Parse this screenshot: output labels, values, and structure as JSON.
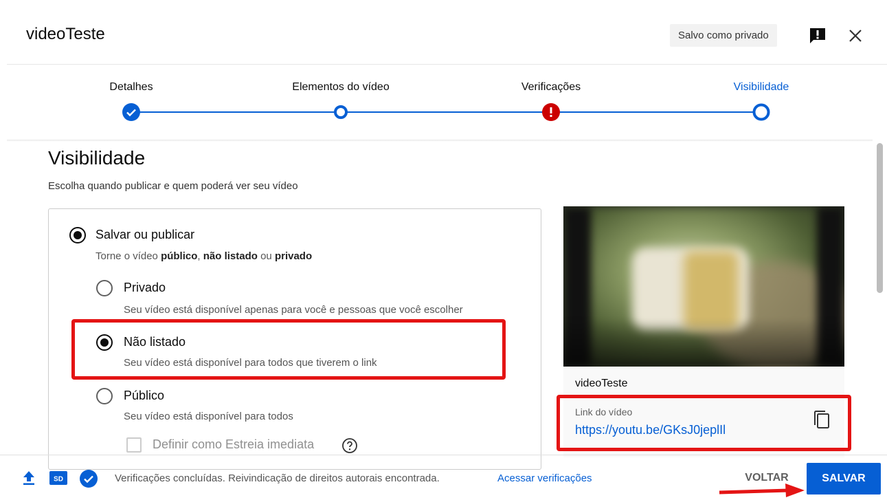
{
  "header": {
    "title": "videoTeste",
    "saved_status": "Salvo como privado",
    "feedback_icon": "feedback-icon",
    "close_icon": "close-icon"
  },
  "stepper": {
    "steps": [
      {
        "label": "Detalhes",
        "state": "completed"
      },
      {
        "label": "Elementos do vídeo",
        "state": "visited"
      },
      {
        "label": "Verificações",
        "state": "error"
      },
      {
        "label": "Visibilidade",
        "state": "active"
      }
    ]
  },
  "visibility": {
    "title": "Visibilidade",
    "subtitle": "Escolha quando publicar e quem poderá ver seu vídeo",
    "save_publish": {
      "label": "Salvar ou publicar",
      "desc_prefix": "Torne o vídeo ",
      "desc_public": "público",
      "desc_sep": ", ",
      "desc_unlisted": "não listado",
      "desc_or": " ou ",
      "desc_private": "privado",
      "selected": true
    },
    "options": [
      {
        "label": "Privado",
        "desc": "Seu vídeo está disponível apenas para você e pessoas que você escolher",
        "selected": false
      },
      {
        "label": "Não listado",
        "desc": "Seu vídeo está disponível para todos que tiverem o link",
        "selected": true
      },
      {
        "label": "Público",
        "desc": "Seu vídeo está disponível para todos",
        "selected": false
      }
    ],
    "premiere_label": "Definir como Estreia imediata",
    "premiere_checked": false
  },
  "preview": {
    "video_name": "videoTeste",
    "link_caption": "Link do vídeo",
    "link_url": "https://youtu.be/GKsJ0jeplIl"
  },
  "footer": {
    "status": "Verificações concluídas. Reivindicação de direitos autorais encontrada.",
    "link": "Acessar verificações",
    "back_label": "VOLTAR",
    "save_label": "SALVAR",
    "sd_badge": "SD"
  },
  "colors": {
    "accent": "#065fd4",
    "error": "#cc0000",
    "annotation": "#e41414"
  }
}
